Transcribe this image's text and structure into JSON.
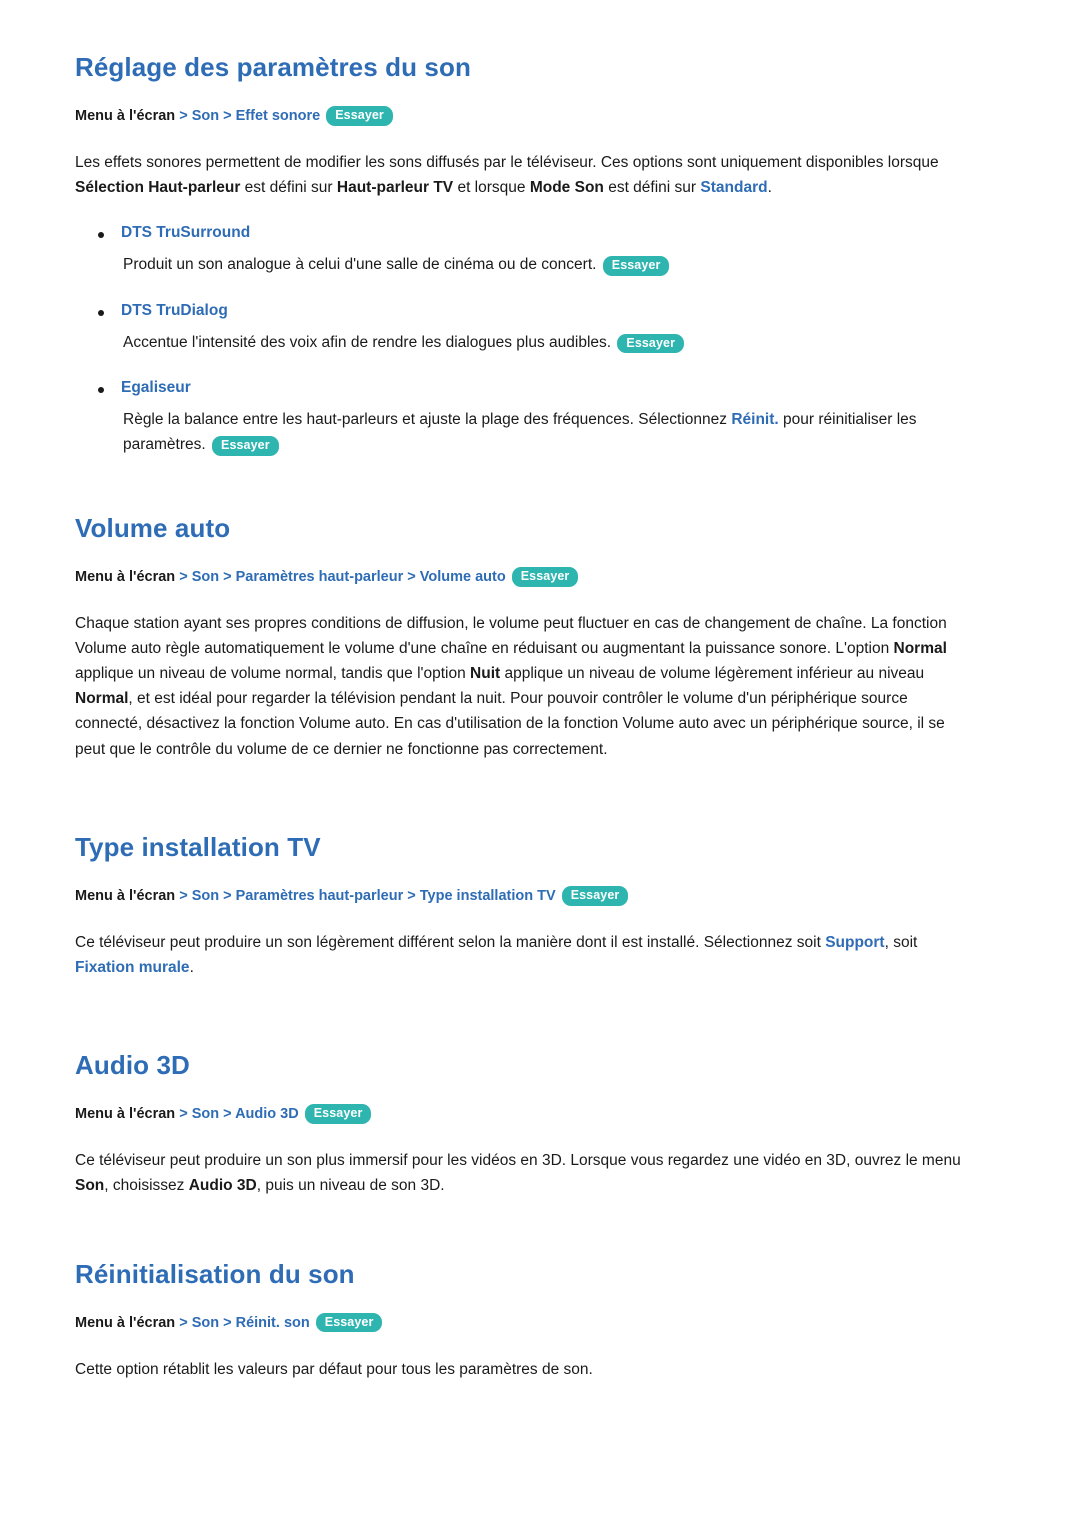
{
  "sections": [
    {
      "id": "sound-settings",
      "title": "Réglage des paramètres du son",
      "breadcrumb": {
        "prefix": "Menu à l'écran",
        "items": [
          "Son",
          "Effet sonore"
        ],
        "try_label": "Essayer"
      },
      "intro": {
        "part1": "Les effets sonores permettent de modifier les sons diffusés par le téléviseur. Ces options sont uniquement disponibles lorsque ",
        "b1": "Sélection Haut-parleur",
        "part2": " est défini sur ",
        "b2": "Haut-parleur TV",
        "part3": " et lorsque ",
        "b3": "Mode Son",
        "part4": " est défini sur ",
        "b4": "Standard",
        "part5": "."
      },
      "bullets": [
        {
          "label": "DTS TruSurround",
          "text": "Produit un son analogue à celui d'une salle de cinéma ou de concert.",
          "try_label": "Essayer"
        },
        {
          "label": "DTS TruDialog",
          "text": "Accentue l'intensité des voix afin de rendre les dialogues plus audibles.",
          "try_label": "Essayer"
        },
        {
          "label": "Egaliseur",
          "text_a": "Règle la balance entre les haut-parleurs et ajuste la plage des fréquences. Sélectionnez ",
          "text_b": "Réinit.",
          "text_c": " pour réinitialiser les paramètres.",
          "try_label": "Essayer"
        }
      ]
    },
    {
      "id": "auto-volume",
      "title": "Volume auto",
      "breadcrumb": {
        "prefix": "Menu à l'écran",
        "items": [
          "Son",
          "Paramètres haut-parleur",
          "Volume auto"
        ],
        "try_label": "Essayer"
      },
      "paragraph": {
        "p1": "Chaque station ayant ses propres conditions de diffusion, le volume peut fluctuer en cas de changement de chaîne. La fonction Volume auto règle automatiquement le volume d'une chaîne en réduisant ou augmentant la puissance sonore. L'option ",
        "b1": "Normal",
        "p2": " applique un niveau de volume normal, tandis que l'option ",
        "b2": "Nuit",
        "p3": " applique un niveau de volume légèrement inférieur au niveau ",
        "b3": "Normal",
        "p4": ", et est idéal pour regarder la télévision pendant la nuit. Pour pouvoir contrôler le volume d'un périphérique source connecté, désactivez la fonction Volume auto. En cas d'utilisation de la fonction Volume auto avec un périphérique source, il se peut que le contrôle du volume de ce dernier ne fonctionne pas correctement."
      }
    },
    {
      "id": "tv-installation-type",
      "title": "Type installation TV",
      "breadcrumb": {
        "prefix": "Menu à l'écran",
        "items": [
          "Son",
          "Paramètres haut-parleur",
          "Type installation TV"
        ],
        "try_label": "Essayer"
      },
      "paragraph": {
        "p1": "Ce téléviseur peut produire un son légèrement différent selon la manière dont il est installé. Sélectionnez soit ",
        "b1": "Support",
        "p2": ", soit ",
        "b2": "Fixation murale",
        "p3": "."
      }
    },
    {
      "id": "audio-3d",
      "title": "Audio 3D",
      "breadcrumb": {
        "prefix": "Menu à l'écran",
        "items": [
          "Son",
          "Audio 3D"
        ],
        "try_label": "Essayer"
      },
      "paragraph": {
        "p1": "Ce téléviseur peut produire un son plus immersif pour les vidéos en 3D. Lorsque vous regardez une vidéo en 3D, ouvrez le menu ",
        "b1": "Son",
        "p2": ", choisissez ",
        "b2": "Audio 3D",
        "p3": ", puis un niveau de son 3D."
      }
    },
    {
      "id": "sound-reset",
      "title": "Réinitialisation du son",
      "breadcrumb": {
        "prefix": "Menu à l'écran",
        "items": [
          "Son",
          "Réinit. son"
        ],
        "try_label": "Essayer"
      },
      "paragraph": {
        "p1": "Cette option rétablit les valeurs par défaut pour tous les paramètres de son."
      }
    }
  ],
  "separator": ">",
  "colors": {
    "heading_blue": "#2e6cb5",
    "try_badge": "#2fb5b0",
    "body_text": "#1a1a1a"
  }
}
